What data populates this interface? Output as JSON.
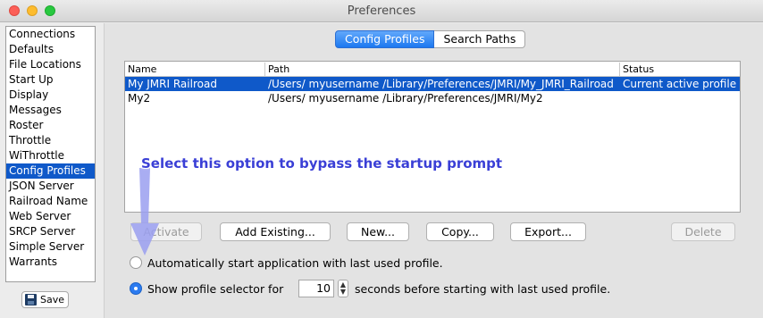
{
  "window": {
    "title": "Preferences"
  },
  "sidebar": {
    "items": [
      {
        "label": "Connections"
      },
      {
        "label": "Defaults"
      },
      {
        "label": "File Locations"
      },
      {
        "label": "Start Up"
      },
      {
        "label": "Display"
      },
      {
        "label": "Messages"
      },
      {
        "label": "Roster"
      },
      {
        "label": "Throttle"
      },
      {
        "label": "WiThrottle"
      },
      {
        "label": "Config Profiles",
        "selected": true
      },
      {
        "label": "JSON Server"
      },
      {
        "label": "Railroad Name"
      },
      {
        "label": "Web Server"
      },
      {
        "label": "SRCP Server"
      },
      {
        "label": "Simple Server"
      },
      {
        "label": "Warrants"
      }
    ],
    "save_label": "Save"
  },
  "tabs": [
    {
      "label": "Config Profiles",
      "active": true
    },
    {
      "label": "Search Paths",
      "active": false
    }
  ],
  "table": {
    "columns": [
      "Name",
      "Path",
      "Status"
    ],
    "rows": [
      {
        "name": "My JMRI Railroad",
        "path": "/Users/ myusername /Library/Preferences/JMRI/My_JMRI_Railroad",
        "status": "Current active profile",
        "selected": true
      },
      {
        "name": "My2",
        "path": "/Users/ myusername /Library/Preferences/JMRI/My2",
        "status": "",
        "selected": false
      }
    ]
  },
  "buttons": {
    "activate": "Activate",
    "add_existing": "Add Existing...",
    "new": "New...",
    "copy": "Copy...",
    "export": "Export...",
    "delete": "Delete"
  },
  "options": {
    "auto_start_label": "Automatically start application with last used profile.",
    "auto_start_selected": false,
    "show_selector_label": "Show profile selector for",
    "show_selector_selected": true,
    "seconds_value": "10",
    "seconds_suffix": "seconds before starting with last used profile."
  },
  "annotation": {
    "text": "Select this option to bypass the startup prompt"
  },
  "colors": {
    "selection": "#0f59c9",
    "tab_active": "#1c78f0",
    "annotation": "#3a3fd6",
    "arrow": "#9a9ff0"
  }
}
